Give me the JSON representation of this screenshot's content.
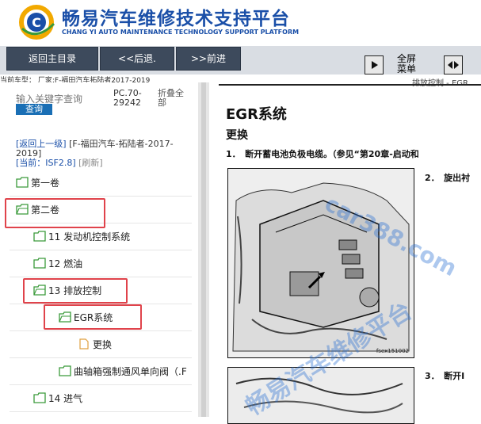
{
  "header": {
    "brand_title": "畅易汽车维修技术支持平台",
    "brand_subtitle": "CHANG YI AUTO MAINTENANCE TECHNOLOGY SUPPORT PLATFORM",
    "logo_letter": "C"
  },
  "toolbar": {
    "home_label": "返回主目录",
    "back_label": "<<后退.",
    "forward_label": ">>前进",
    "fullscreen_label": "全屏 菜单"
  },
  "vehicle_line": "当前车型： 厂家:F-福田汽车拓陆者2017-2019",
  "sidebar": {
    "search_placeholder": "输入关键字查询",
    "search_button": "查询",
    "code": "PC.70-29242",
    "collapse_all": "折叠全部",
    "breadcrumb": {
      "up": "[返回上一级]",
      "model": "[F-福田汽车-拓陆者-2017-2019]",
      "current": "[当前：ISF2.8]",
      "refresh": "[刷新]"
    },
    "tree": [
      {
        "label": "第一卷"
      },
      {
        "label": "第二卷"
      },
      {
        "label": "11 发动机控制系统"
      },
      {
        "label": "12 燃油"
      },
      {
        "label": "13 排放控制"
      },
      {
        "label": "EGR系统"
      },
      {
        "label": "更换"
      },
      {
        "label": "曲轴箱强制通风单向阀（.F"
      },
      {
        "label": "14 进气"
      }
    ]
  },
  "document": {
    "section_tab": "排放控制 - EGR",
    "title": "EGR系统",
    "subtitle": "更换",
    "step1": "1．　断开蓄电池负极电缆。（参见“第20章-启动和",
    "step2": "2．　旋出衬",
    "step3": "3．　断开I",
    "figure_caption": "fsex151002"
  },
  "watermark": {
    "site": "car388.com",
    "platform": "畅易汽车维修平台"
  }
}
